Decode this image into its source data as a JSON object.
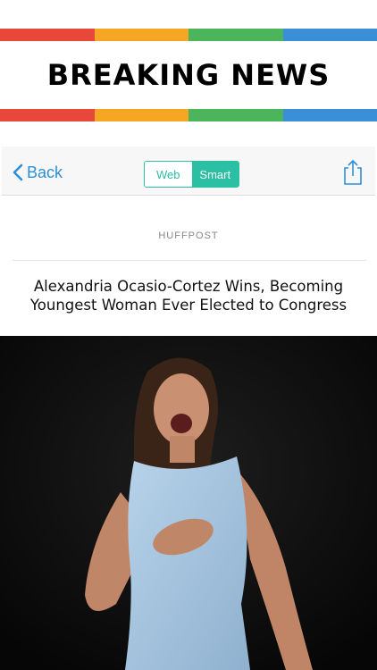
{
  "banner": {
    "title": "BREAKING NEWS",
    "stripe_colors": [
      "#e8483a",
      "#f5a623",
      "#4cb45a",
      "#3a8fd6"
    ]
  },
  "toolbar": {
    "back_label": "Back",
    "segments": {
      "web_label": "Web",
      "smart_label": "Smart",
      "selected": "Smart"
    },
    "accent_color": "#2bbfa4",
    "link_color": "#2f8fd6",
    "icons": {
      "back": "chevron-left-icon",
      "share": "share-icon"
    }
  },
  "article": {
    "source": "HUFFPOST",
    "title": "Alexandria Ocasio-Cortez Wins, Becoming Youngest Woman Ever Elected to Congress"
  }
}
